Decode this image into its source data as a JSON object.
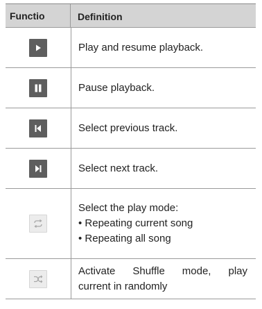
{
  "table": {
    "headers": {
      "function": "Functio",
      "definition": "Definition"
    },
    "rows": [
      {
        "icon": "play-icon",
        "lines": [
          "Play and resume playback."
        ]
      },
      {
        "icon": "pause-icon",
        "lines": [
          "Pause playback."
        ]
      },
      {
        "icon": "previous-track-icon",
        "lines": [
          "Select previous track."
        ]
      },
      {
        "icon": "next-track-icon",
        "lines": [
          "Select next track."
        ]
      },
      {
        "icon": "repeat-icon",
        "lines": [
          "Select the play mode:",
          "• Repeating current song",
          "• Repeating all song"
        ]
      },
      {
        "icon": "shuffle-icon",
        "lines": [
          "Activate Shuffle mode, play",
          "current in randomly"
        ]
      }
    ]
  },
  "colors": {
    "header_bg": "#d4d4d4",
    "icon_dark": "#5e5e5e",
    "icon_light": "#ececec"
  }
}
